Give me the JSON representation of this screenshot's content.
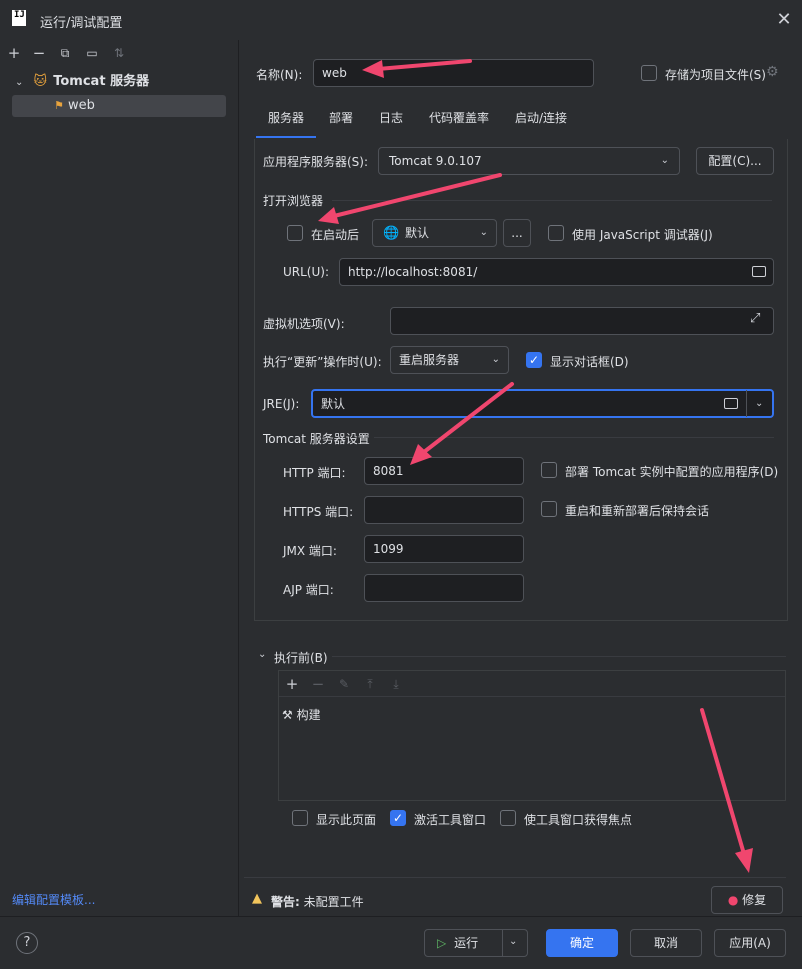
{
  "window": {
    "title": "运行/调试配置",
    "logo": "IJ"
  },
  "sidebar": {
    "toolbar": [
      "add-icon",
      "remove-icon",
      "copy-icon",
      "folder-add-icon",
      "sort-icon"
    ],
    "group": "Tomcat 服务器",
    "item": "web",
    "edit_templates": "编辑配置模板..."
  },
  "header": {
    "name_label": "名称(N):",
    "name_value": "web",
    "store_label": "存储为项目文件(S)"
  },
  "tabs": [
    "服务器",
    "部署",
    "日志",
    "代码覆盖率",
    "启动/连接"
  ],
  "server": {
    "app_server_label": "应用程序服务器(S):",
    "app_server_value": "Tomcat 9.0.107",
    "configure_btn": "配置(C)...",
    "open_browser": "打开浏览器",
    "after_launch": "在启动后",
    "browser_value": "默认",
    "more_btn": "...",
    "js_debugger": "使用 JavaScript 调试器(J)",
    "url_label": "URL(U):",
    "url_value": "http://localhost:8081/",
    "vm_label": "虚拟机选项(V):",
    "update_label": "执行“更新”操作时(U):",
    "update_value": "重启服务器",
    "show_dialog": "显示对话框(D)",
    "jre_label": "JRE(J):",
    "jre_value": "默认",
    "tomcat_settings": "Tomcat 服务器设置",
    "http_label": "HTTP 端口:",
    "http_value": "8081",
    "https_label": "HTTPS 端口:",
    "https_value": "",
    "jmx_label": "JMX 端口:",
    "jmx_value": "1099",
    "ajp_label": "AJP 端口:",
    "ajp_value": "",
    "deploy_apps": "部署 Tomcat 实例中配置的应用程序(D)",
    "preserve_sessions": "重启和重新部署后保持会话"
  },
  "before": {
    "title": "执行前(B)",
    "task": "构建",
    "show_page": "显示此页面",
    "activate_tool": "激活工具窗口",
    "focus_tool": "使工具窗口获得焦点"
  },
  "warning": {
    "bold": "警告:",
    "text": "未配置工件",
    "fix_btn": "修复"
  },
  "footer": {
    "help": "?",
    "run": "运行",
    "ok": "确定",
    "cancel": "取消",
    "apply": "应用(A)"
  },
  "colors": {
    "accent": "#3574f0",
    "arrow": "#f0466e",
    "bg": "#2b2d30",
    "input_bg": "#1e1f22"
  }
}
